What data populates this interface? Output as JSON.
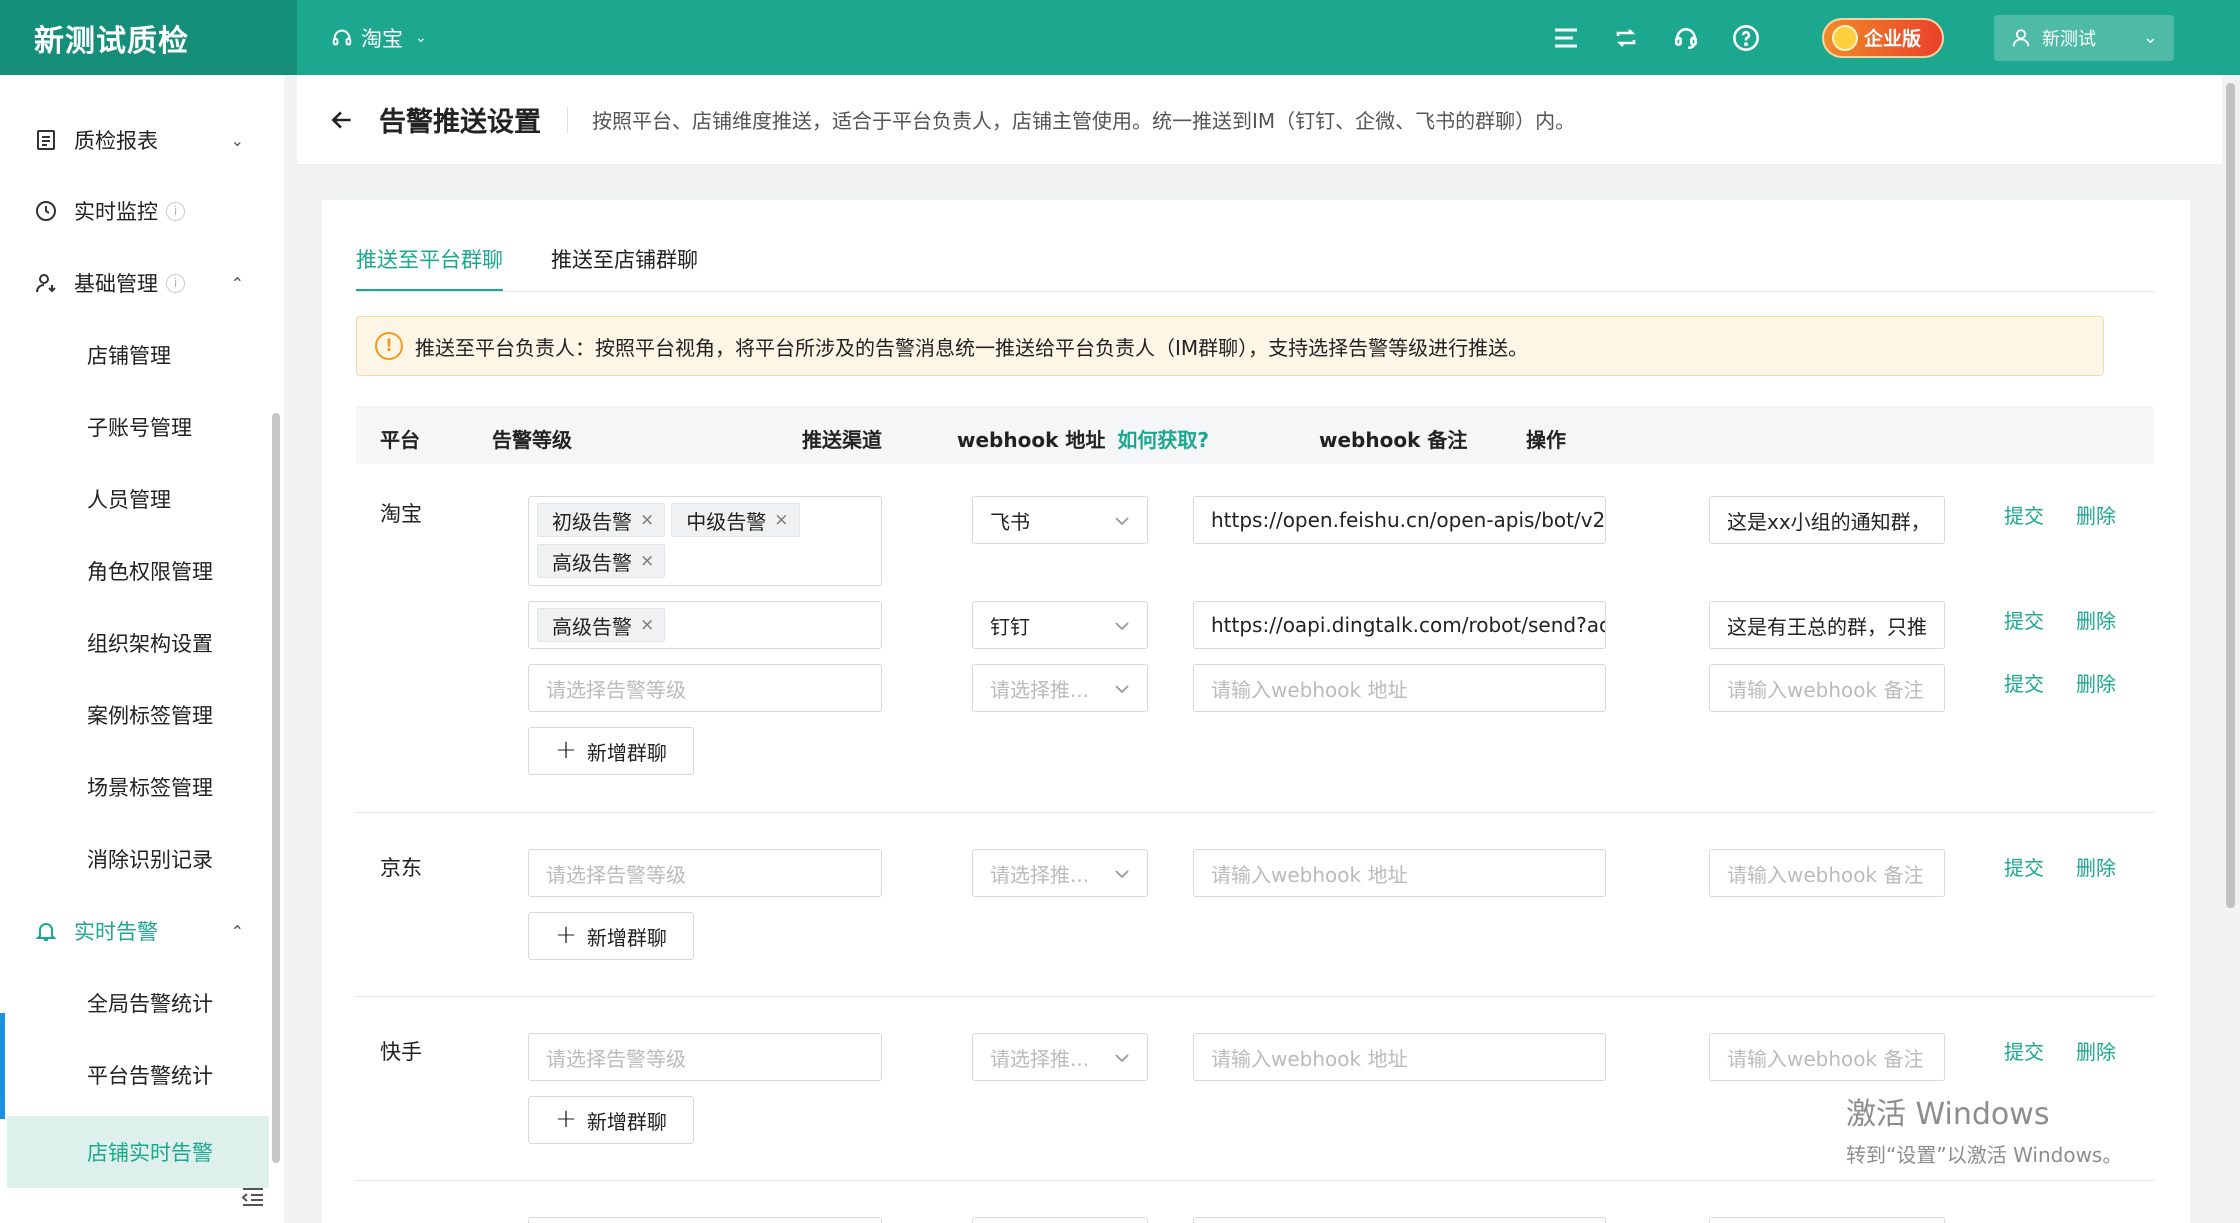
{
  "app": {
    "title": "新测试质检",
    "platform": "淘宝"
  },
  "header_badge": "企业版",
  "user": {
    "name": "新测试"
  },
  "sidebar": {
    "items": [
      {
        "label": "质检报表"
      },
      {
        "label": "实时监控"
      },
      {
        "label": "基础管理"
      },
      {
        "label": "店铺管理"
      },
      {
        "label": "子账号管理"
      },
      {
        "label": "人员管理"
      },
      {
        "label": "角色权限管理"
      },
      {
        "label": "组织架构设置"
      },
      {
        "label": "案例标签管理"
      },
      {
        "label": "场景标签管理"
      },
      {
        "label": "消除识别记录"
      },
      {
        "label": "实时告警"
      },
      {
        "label": "全局告警统计"
      },
      {
        "label": "平台告警统计"
      },
      {
        "label": "店铺实时告警"
      }
    ]
  },
  "page": {
    "title": "告警推送设置",
    "description": "按照平台、店铺维度推送，适合于平台负责人，店铺主管使用。统一推送到IM（钉钉、企微、飞书的群聊）内。"
  },
  "tabs": [
    {
      "label": "推送至平台群聊"
    },
    {
      "label": "推送至店铺群聊"
    }
  ],
  "alert": "推送至平台负责人：按照平台视角，将平台所涉及的告警消息统一推送给平台负责人（IM群聊），支持选择告警等级进行推送。",
  "table": {
    "headers": {
      "platform": "平台",
      "level": "告警等级",
      "channel": "推送渠道",
      "webhook": "webhook 地址",
      "webhook_link": "如何获取?",
      "remark": "webhook 备注",
      "ops": "操作"
    },
    "placeholders": {
      "level": "请选择告警等级",
      "channel": "请选择推...",
      "webhook": "请输入webhook 地址",
      "remark": "请输入webhook 备注"
    },
    "add_group": "新增群聊",
    "submit": "提交",
    "delete": "删除",
    "rows": [
      {
        "platform": "淘宝",
        "groups": [
          {
            "levels": [
              "初级告警",
              "中级告警",
              "高级告警"
            ],
            "channel": "飞书",
            "webhook": "https://open.feishu.cn/open-apis/bot/v2/",
            "remark": "这是xx小组的通知群，"
          },
          {
            "levels": [
              "高级告警"
            ],
            "channel": "钉钉",
            "webhook": "https://oapi.dingtalk.com/robot/send?ac",
            "remark": "这是有王总的群，只推"
          }
        ]
      },
      {
        "platform": "京东"
      },
      {
        "platform": "快手"
      }
    ]
  },
  "watermark": {
    "line1": "激活 Windows",
    "line2": "转到“设置”以激活 Windows。"
  }
}
